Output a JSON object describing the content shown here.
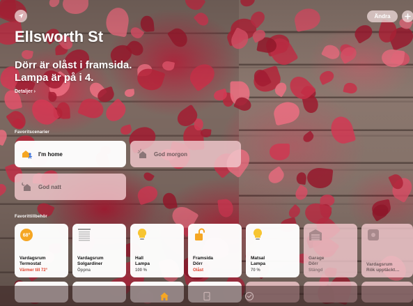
{
  "app": {
    "home_name": "Ellsworth St",
    "status_lines": [
      "Dörr är olåst i framsida.",
      "Lampa är på i 4."
    ],
    "details_link": "Detaljer ›",
    "edit_label": "Ändra"
  },
  "sections": {
    "scenes_label": "Favoritscenarier",
    "accessories_label": "Favorittillbehör"
  },
  "scenes": [
    {
      "label": "I'm home",
      "active": true,
      "icon": "arrive-home-icon"
    },
    {
      "label": "God morgon",
      "active": false,
      "icon": "morning-house-icon"
    },
    {
      "label": "God natt",
      "active": false,
      "icon": "night-house-icon"
    }
  ],
  "accessories": [
    {
      "room": "Vardagsrum",
      "name": "Termostat",
      "state": "Värmer till 72°",
      "active": true,
      "alert": true,
      "icon": "thermostat-icon"
    },
    {
      "room": "Vardagsrum",
      "name": "Solgardiner",
      "state": "Öppna",
      "active": true,
      "alert": false,
      "icon": "blinds-icon"
    },
    {
      "room": "Hall",
      "name": "Lampa",
      "state": "100 %",
      "active": true,
      "alert": false,
      "icon": "lightbulb-icon"
    },
    {
      "room": "Framsida",
      "name": "Dörr",
      "state": "Olåst",
      "active": true,
      "alert": true,
      "icon": "unlocked-icon"
    },
    {
      "room": "Matsal",
      "name": "Lampa",
      "state": "70 %",
      "active": true,
      "alert": false,
      "icon": "lightbulb-icon"
    },
    {
      "room": "Garage",
      "name": "Dörr",
      "state": "Stängd",
      "active": false,
      "alert": false,
      "icon": "garage-icon"
    },
    {
      "room": "Vardagsrum",
      "name": "Rök upptäckt…",
      "state": "",
      "active": false,
      "alert": false,
      "icon": "smoke-detector-icon"
    }
  ],
  "tabs": [
    {
      "label": "Hem",
      "icon": "home-tab-icon",
      "selected": true
    },
    {
      "label": "Rum",
      "icon": "rooms-tab-icon",
      "selected": false
    },
    {
      "label": "Automatisering",
      "icon": "automation-tab-icon",
      "selected": false
    }
  ],
  "colors": {
    "accent": "#f5a623",
    "alert": "#e0402a",
    "tile_on": "#ffffff",
    "tile_off": "#f2c8cd"
  }
}
